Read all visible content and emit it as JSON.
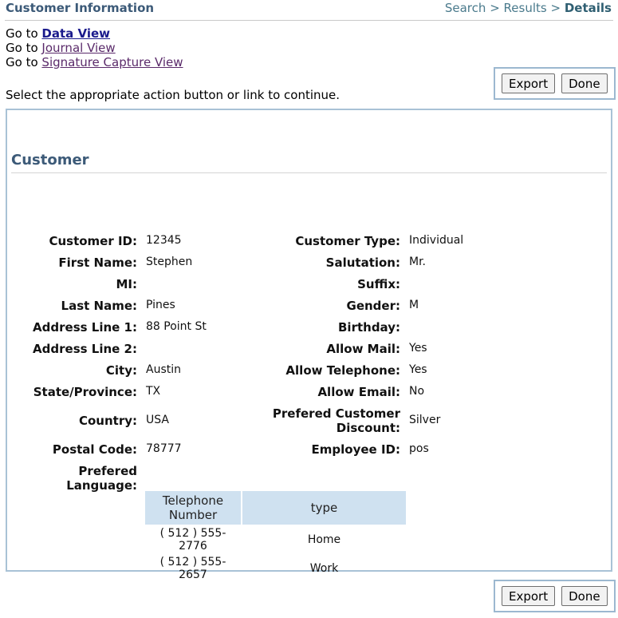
{
  "header": {
    "title": "Customer Information",
    "breadcrumb": [
      "Search",
      "Results",
      "Details"
    ],
    "separator": ">"
  },
  "goto": {
    "prefix": "Go to",
    "links": [
      "Data View",
      "Journal View",
      "Signature Capture View"
    ]
  },
  "instructions": "Select the appropriate action button or link to continue.",
  "buttons": {
    "export": "Export",
    "done": "Done"
  },
  "section_title": "Customer",
  "left_fields": [
    {
      "label": "Customer ID:",
      "value": "12345"
    },
    {
      "label": "First Name:",
      "value": "Stephen"
    },
    {
      "label": "MI:",
      "value": ""
    },
    {
      "label": "Last Name:",
      "value": "Pines"
    },
    {
      "label": "Address Line 1:",
      "value": "88 Point St"
    },
    {
      "label": "Address Line 2:",
      "value": ""
    },
    {
      "label": "City:",
      "value": "Austin"
    },
    {
      "label": "State/Province:",
      "value": "TX"
    },
    {
      "label": "Country:",
      "value": "USA"
    },
    {
      "label": "Postal Code:",
      "value": "78777"
    },
    {
      "label": "Prefered Language:",
      "value": ""
    }
  ],
  "right_fields": [
    {
      "label": "Customer Type:",
      "value": "Individual"
    },
    {
      "label": "Salutation:",
      "value": "Mr."
    },
    {
      "label": "Suffix:",
      "value": ""
    },
    {
      "label": "Gender:",
      "value": "M"
    },
    {
      "label": "Birthday:",
      "value": ""
    },
    {
      "label": "Allow Mail:",
      "value": "Yes"
    },
    {
      "label": "Allow Telephone:",
      "value": "Yes"
    },
    {
      "label": "Allow Email:",
      "value": "No"
    },
    {
      "label_line1": "Prefered Customer",
      "label_line2": "Discount:",
      "value": "Silver"
    },
    {
      "label": "Employee ID:",
      "value": "pos"
    }
  ],
  "telephone_table": {
    "headers": {
      "number_line1": "Telephone",
      "number_line2": "Number",
      "type": "type"
    },
    "rows": [
      {
        "number": "( 512 ) 555-2776",
        "type": "Home"
      },
      {
        "number": "( 512 ) 555-2657",
        "type": "Work"
      }
    ]
  }
}
